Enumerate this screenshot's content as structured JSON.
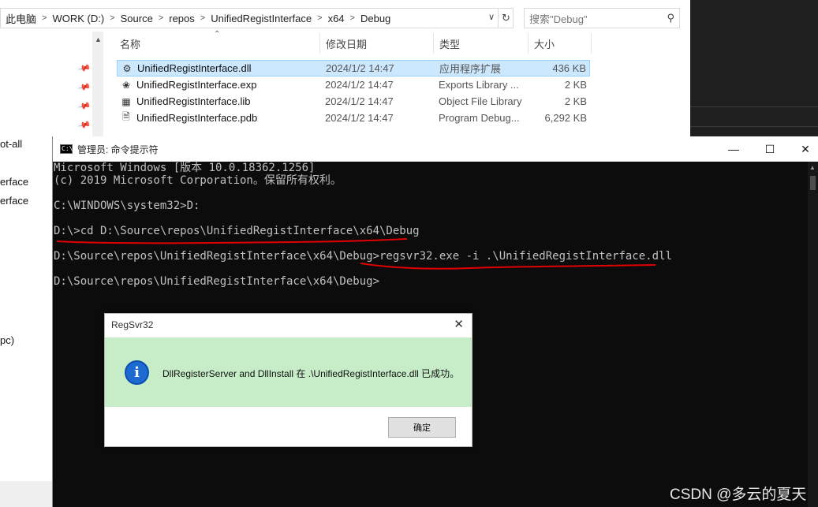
{
  "explorer": {
    "breadcrumbs": [
      "此电脑",
      "WORK (D:)",
      "Source",
      "repos",
      "UnifiedRegistInterface",
      "x64",
      "Debug"
    ],
    "search_placeholder": "搜索\"Debug\"",
    "columns": {
      "name": "名称",
      "modified": "修改日期",
      "type": "类型",
      "size": "大小"
    },
    "files": [
      {
        "name": "UnifiedRegistInterface.dll",
        "modified": "2024/1/2 14:47",
        "type": "应用程序扩展",
        "size": "436 KB",
        "icon": "dll-file-icon",
        "selected": true
      },
      {
        "name": "UnifiedRegistInterface.exp",
        "modified": "2024/1/2 14:47",
        "type": "Exports Library ...",
        "size": "2 KB",
        "icon": "exp-file-icon",
        "selected": false
      },
      {
        "name": "UnifiedRegistInterface.lib",
        "modified": "2024/1/2 14:47",
        "type": "Object File Library",
        "size": "2 KB",
        "icon": "lib-file-icon",
        "selected": false
      },
      {
        "name": "UnifiedRegistInterface.pdb",
        "modified": "2024/1/2 14:47",
        "type": "Program Debug...",
        "size": "6,292 KB",
        "icon": "pdb-file-icon",
        "selected": false
      }
    ],
    "nav_fragments": [
      "ot-all",
      "erface",
      "erface",
      "pc)"
    ]
  },
  "cmd": {
    "title": "管理员: 命令提示符",
    "lines": [
      "Microsoft Windows [版本 10.0.18362.1256]",
      "(c) 2019 Microsoft Corporation。保留所有权利。",
      "",
      "C:\\WINDOWS\\system32>D:",
      "",
      "D:\\>cd D:\\Source\\repos\\UnifiedRegistInterface\\x64\\Debug",
      "",
      "D:\\Source\\repos\\UnifiedRegistInterface\\x64\\Debug>regsvr32.exe -i .\\UnifiedRegistInterface.dll",
      "",
      "D:\\Source\\repos\\UnifiedRegistInterface\\x64\\Debug>"
    ]
  },
  "dialog": {
    "title": "RegSvr32",
    "message": "DllRegisterServer and DllInstall 在 .\\UnifiedRegistInterface.dll 已成功。",
    "ok_label": "确定"
  },
  "watermark": "CSDN @多云的夏天",
  "colors": {
    "selection": "#cce8ff",
    "console_bg": "#0c0c0c",
    "console_text": "#c0c0c0",
    "dialog_body": "#c6edc7",
    "annotation": "#e00000"
  }
}
